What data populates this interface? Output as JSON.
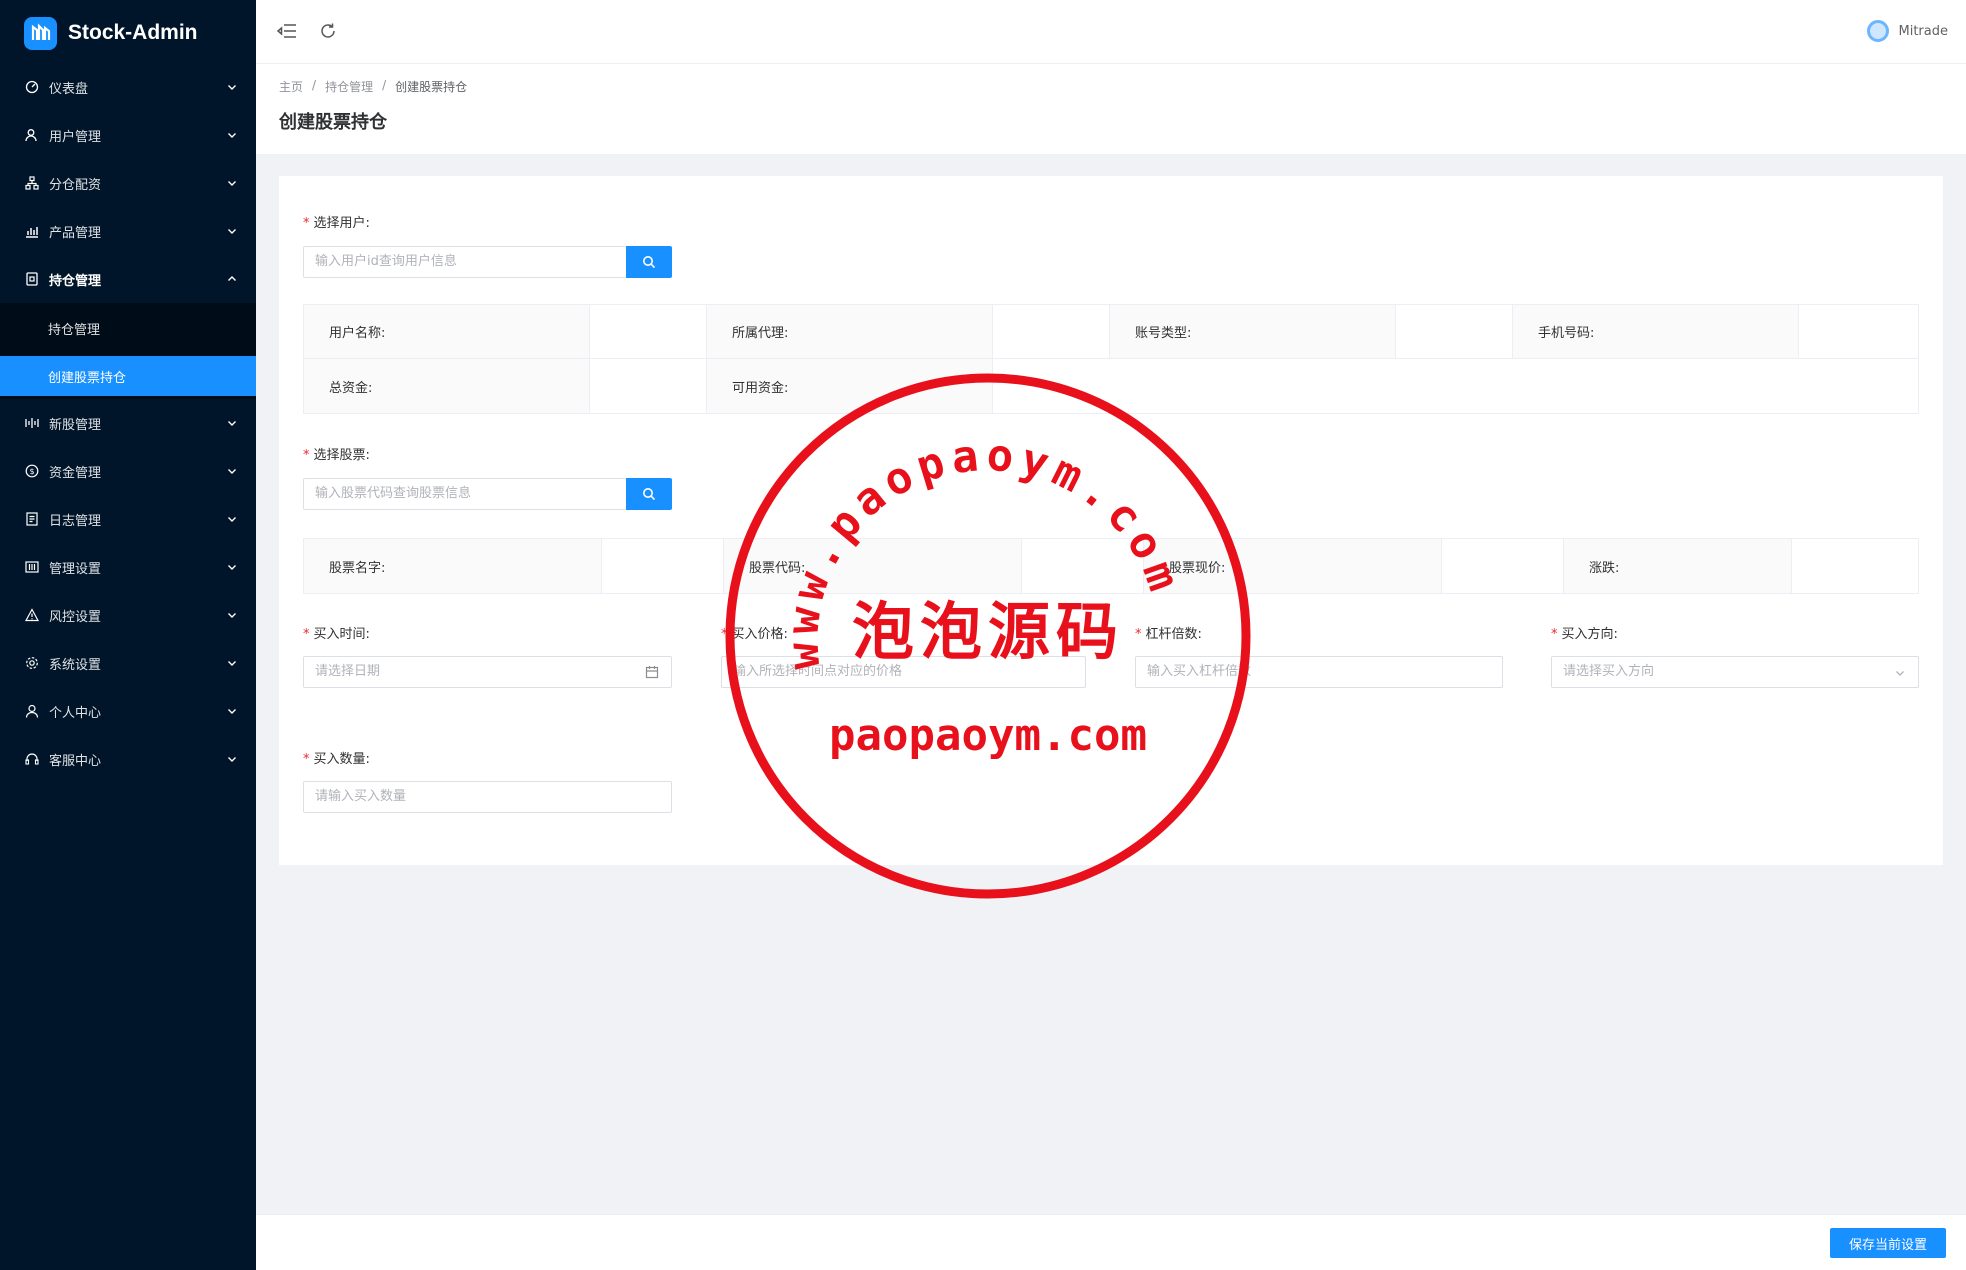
{
  "app": {
    "title": "Stock-Admin"
  },
  "sidebar": {
    "items": [
      {
        "label": "仪表盘",
        "icon": "dashboard-icon"
      },
      {
        "label": "用户管理",
        "icon": "users-icon"
      },
      {
        "label": "分仓配资",
        "icon": "sitemap-icon"
      },
      {
        "label": "产品管理",
        "icon": "bar-chart-icon"
      },
      {
        "label": "持仓管理",
        "icon": "position-icon"
      },
      {
        "label": "新股管理",
        "icon": "new-stock-icon"
      },
      {
        "label": "资金管理",
        "icon": "money-icon"
      },
      {
        "label": "日志管理",
        "icon": "log-icon"
      },
      {
        "label": "管理设置",
        "icon": "admin-settings-icon"
      },
      {
        "label": "风控设置",
        "icon": "warning-icon"
      },
      {
        "label": "系统设置",
        "icon": "gear-icon"
      },
      {
        "label": "个人中心",
        "icon": "user-icon"
      },
      {
        "label": "客服中心",
        "icon": "headset-icon"
      }
    ],
    "submenu": [
      {
        "label": "持仓管理"
      },
      {
        "label": "创建股票持仓"
      }
    ]
  },
  "header": {
    "username": "Mitrade"
  },
  "breadcrumb": {
    "items": [
      "主页",
      "/",
      "持仓管理",
      "/",
      "创建股票持仓"
    ]
  },
  "page": {
    "title": "创建股票持仓"
  },
  "form": {
    "select_user_label": "选择用户:",
    "select_user_placeholder": "输入用户id查询用户信息",
    "user_info": {
      "username_label": "用户名称:",
      "agent_label": "所属代理:",
      "account_type_label": "账号类型:",
      "phone_label": "手机号码:",
      "total_funds_label": "总资金:",
      "available_funds_label": "可用资金:"
    },
    "select_stock_label": "选择股票:",
    "select_stock_placeholder": "输入股票代码查询股票信息",
    "stock_info": {
      "name_label": "股票名字:",
      "code_label": "股票代码:",
      "price_label": "股票现价:",
      "change_label": "涨跌:"
    },
    "buy_time_label": "买入时间:",
    "buy_time_placeholder": "请选择日期",
    "buy_price_label": "买入价格:",
    "buy_price_placeholder": "输入所选择时间点对应的价格",
    "leverage_label": "杠杆倍数:",
    "leverage_placeholder": "输入买入杠杆倍数",
    "direction_label": "买入方向:",
    "direction_placeholder": "请选择买入方向",
    "quantity_label": "买入数量:",
    "quantity_placeholder": "请输入买入数量"
  },
  "footer": {
    "save_label": "保存当前设置"
  },
  "watermark": {
    "arc_text": "www.paopaoym.com",
    "center_text": "泡泡源码",
    "bottom_text": "paopaoym.com"
  },
  "colors": {
    "sidebar_bg": "#001529",
    "accent": "#1890ff",
    "stamp": "#e8101a"
  }
}
